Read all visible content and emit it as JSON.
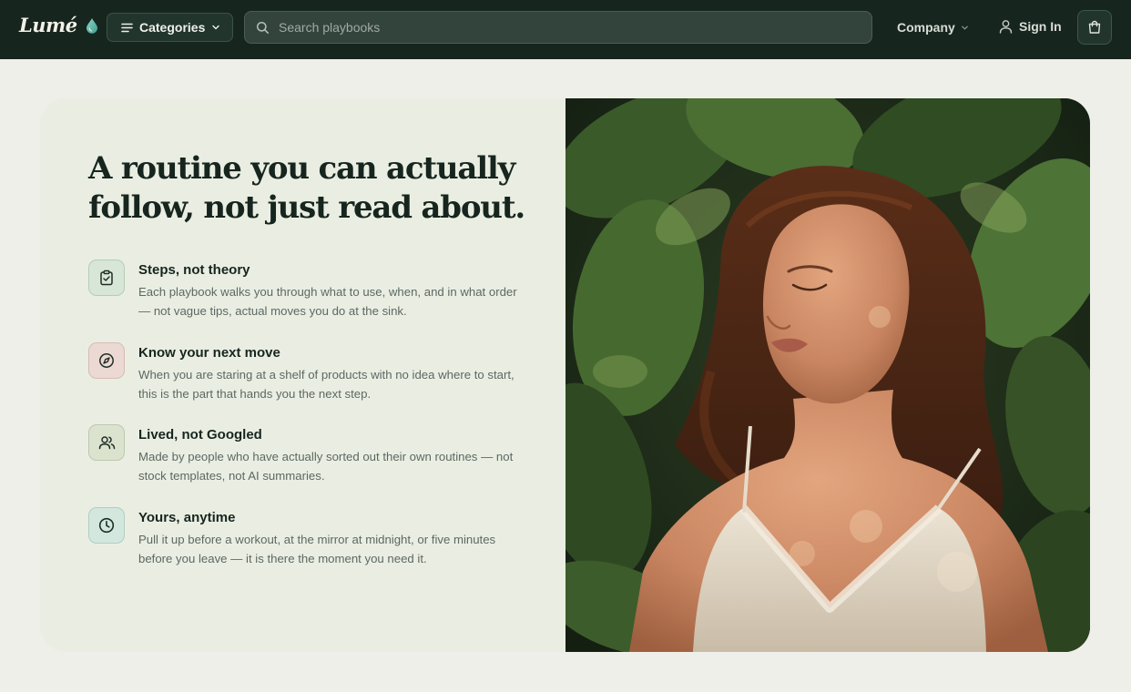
{
  "header": {
    "logo": "Lumé",
    "categories_label": "Categories",
    "search_placeholder": "Search playbooks",
    "company_label": "Company",
    "signin_label": "Sign In"
  },
  "hero": {
    "headline": "A routine you can actually follow, not just read about.",
    "features": [
      {
        "icon": "clipboard-check-icon",
        "title": "Steps, not theory",
        "description": "Each playbook walks you through what to use, when, and in what order — not vague tips, actual moves you do at the sink."
      },
      {
        "icon": "compass-icon",
        "title": "Know your next move",
        "description": "When you are staring at a shelf of products with no idea where to start, this is the part that hands you the next step."
      },
      {
        "icon": "users-icon",
        "title": "Lived, not Googled",
        "description": "Made by people who have actually sorted out their own routines — not stock templates, not AI summaries."
      },
      {
        "icon": "clock-icon",
        "title": "Yours, anytime",
        "description": "Pull it up before a workout, at the mirror at midnight, or five minutes before you leave — it is there the moment you need it."
      }
    ]
  },
  "colors": {
    "header_bg": "#17251f",
    "page_bg": "#efefe9",
    "card_bg": "#eaeee2",
    "heading": "#17251f",
    "body_text": "#5c6863",
    "accent_drop": "#5fb5a8"
  }
}
